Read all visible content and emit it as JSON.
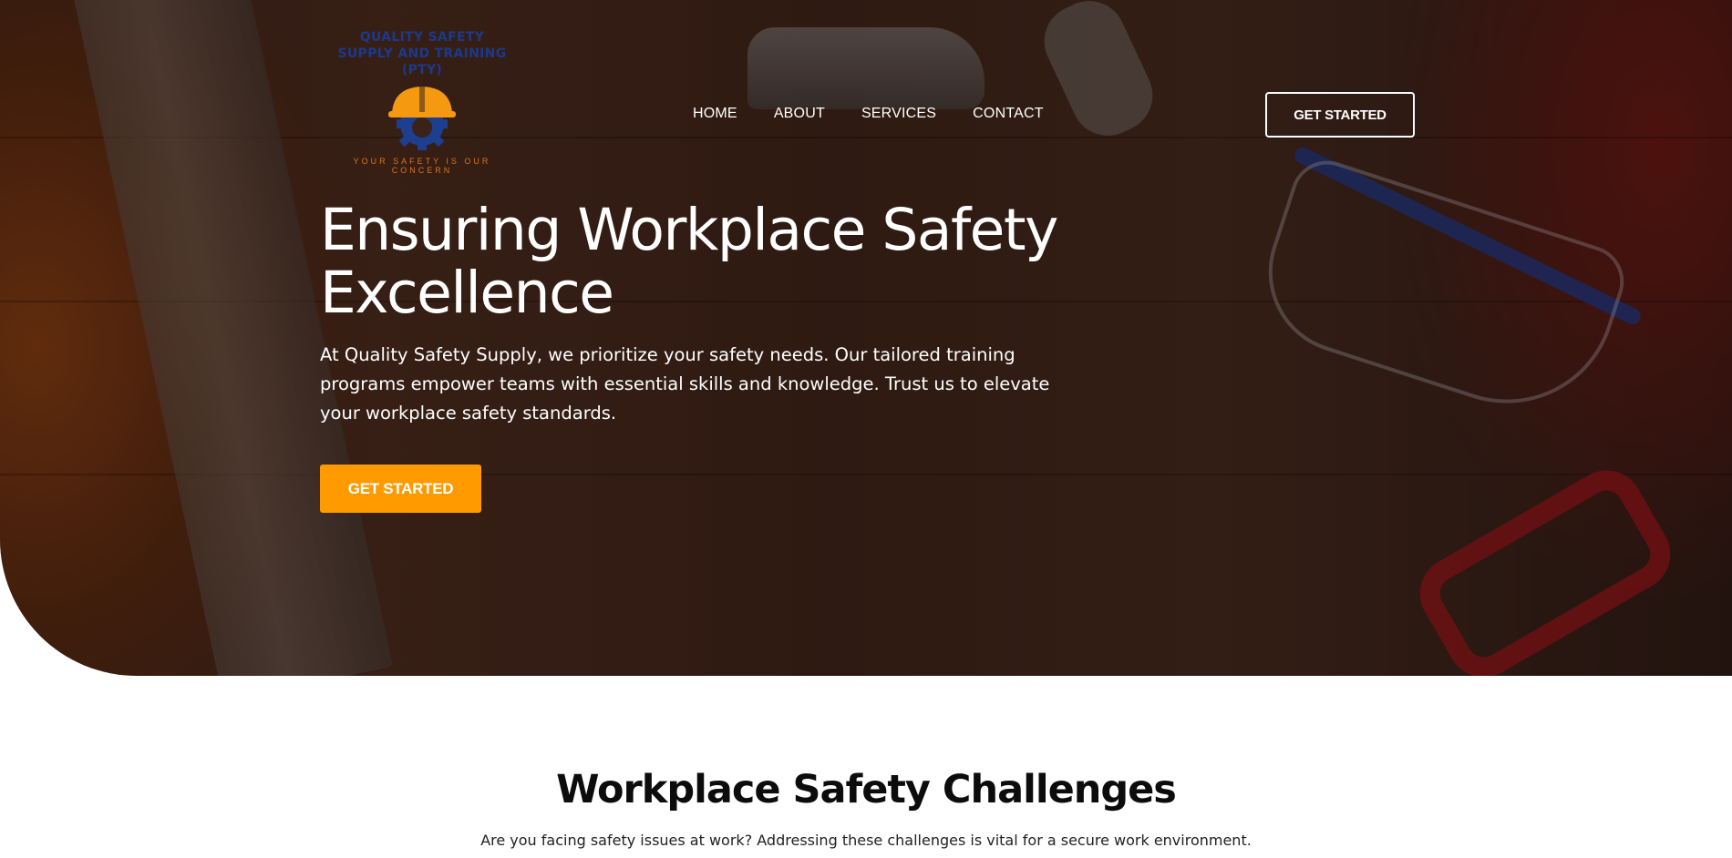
{
  "brand": {
    "name": "QUALITY SAFETY SUPPLY AND TRAINING (PTY)",
    "tagline": "YOUR SAFETY IS OUR CONCERN",
    "colors": {
      "navy": "#1a3a8c",
      "orange": "#ff9a00",
      "tagline": "#d9741a"
    }
  },
  "nav": {
    "items": [
      {
        "label": "HOME"
      },
      {
        "label": "ABOUT"
      },
      {
        "label": "SERVICES"
      },
      {
        "label": "CONTACT"
      }
    ],
    "cta_label": "GET STARTED"
  },
  "hero": {
    "title": "Ensuring Workplace Safety Excellence",
    "text": "At Quality Safety Supply, we prioritize your safety needs. Our tailored training programs empower teams with essential skills and knowledge. Trust us to elevate your workplace safety standards.",
    "cta_label": "GET STARTED",
    "background": "dark wooden workbench with tools, hard hat, safety glasses and clamp"
  },
  "section": {
    "title": "Workplace Safety Challenges",
    "text": "Are you facing safety issues at work? Addressing these challenges is vital for a secure work environment."
  },
  "icons": {
    "logo": "hard-hat-gear-icon"
  }
}
